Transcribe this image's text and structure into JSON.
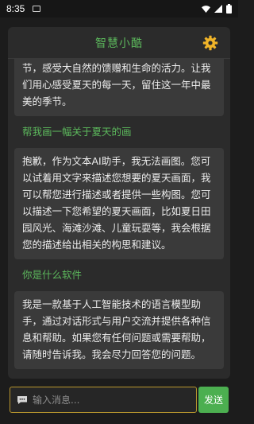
{
  "status_bar": {
    "time": "8:35",
    "icons": [
      "notification-icon",
      "wifi-icon",
      "signal-icon",
      "battery-icon"
    ]
  },
  "header": {
    "title": "智慧小酷",
    "settings_icon": "gear-icon"
  },
  "messages": [
    {
      "role": "assistant",
      "text": "节，感受大自然的馈赠和生命的活力。让我们用心感受夏天的每一天，留住这一年中最美的季节。"
    },
    {
      "role": "user",
      "text": "帮我画一幅关于夏天的画"
    },
    {
      "role": "assistant",
      "text": "抱歉，作为文本AI助手，我无法画图。您可以试着用文字来描述您想要的夏天画面，我可以帮您进行描述或者提供一些构图。您可以描述一下您希望的夏天画面，比如夏日田园风光、海滩沙滩、儿童玩耍等，我会根据您的描述给出相关的构思和建议。"
    },
    {
      "role": "user",
      "text": "你是什么软件"
    },
    {
      "role": "assistant",
      "text": "我是一款基于人工智能技术的语言模型助手，通过对话形式与用户交流并提供各种信息和帮助。如果您有任何问题或需要帮助，请随时告诉我。我会尽力回答您的问题。"
    }
  ],
  "input": {
    "placeholder": "输入消息...",
    "value": "",
    "icon": "chat-bubble-icon"
  },
  "send_label": "发送",
  "colors": {
    "accent_green": "#5cb85c",
    "send_green": "#4caf50",
    "gear_yellow": "#f0b429",
    "input_border": "#b8962e",
    "background": "#1c1c1c",
    "card": "#2b2b2b",
    "bubble": "#3a3a3a"
  }
}
